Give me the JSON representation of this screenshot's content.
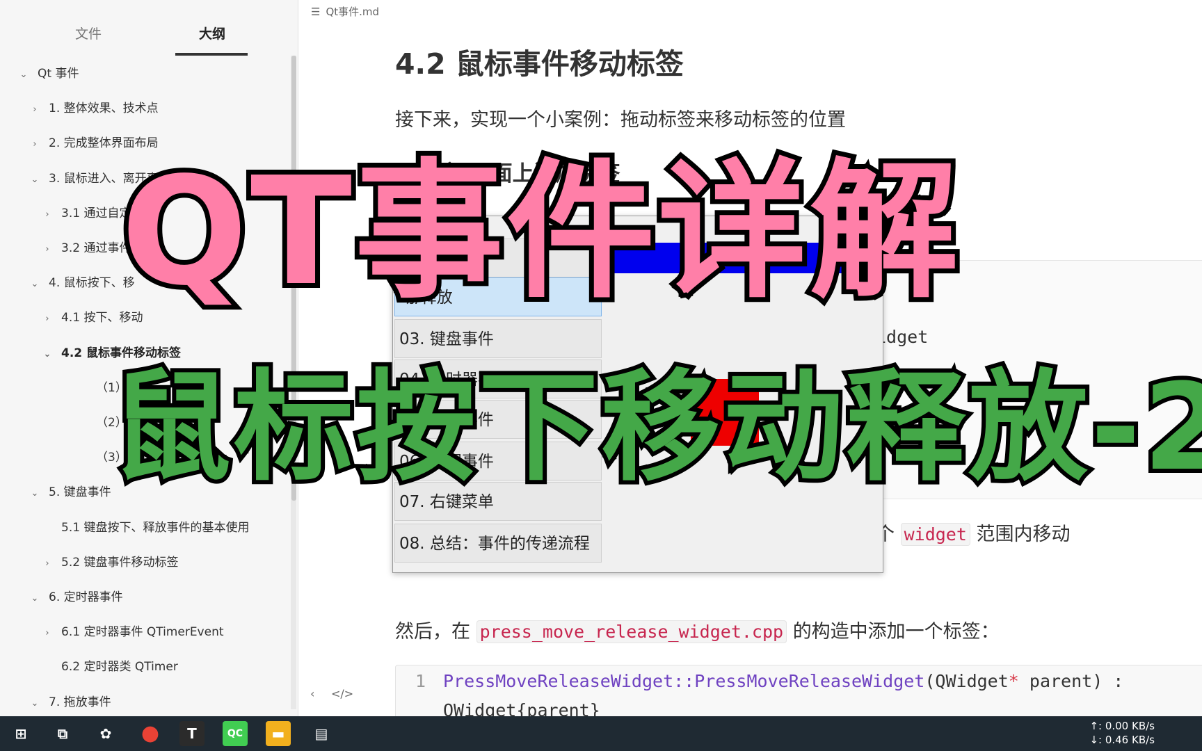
{
  "sidebar": {
    "tabs": {
      "files": "文件",
      "outline": "大纲"
    },
    "outline": [
      {
        "label": "Qt 事件",
        "chevron": "⌄",
        "level": 0
      },
      {
        "label": "1. 整体效果、技术点",
        "chevron": "›",
        "level": 1
      },
      {
        "label": "2. 完成整体界面布局",
        "chevron": "›",
        "level": 1
      },
      {
        "label": "3. 鼠标进入、离开事件",
        "chevron": "⌄",
        "level": 1
      },
      {
        "label": "3.1 通过自定义",
        "chevron": "›",
        "level": 2
      },
      {
        "label": "3.2 通过事件过",
        "chevron": "›",
        "level": 2
      },
      {
        "label": "4. 鼠标按下、移",
        "chevron": "⌄",
        "level": 1
      },
      {
        "label": "4.1 按下、移动",
        "chevron": "›",
        "level": 2
      },
      {
        "label": "4.2 鼠标事件移动标签",
        "chevron": "⌄",
        "level": 2,
        "active": true
      },
      {
        "label": "（1）界",
        "chevron": "",
        "level": 3
      },
      {
        "label": "（2）为",
        "chevron": "",
        "level": 3
      },
      {
        "label": "（3）重",
        "chevron": "",
        "level": 3
      },
      {
        "label": "5. 键盘事件",
        "chevron": "⌄",
        "level": 1
      },
      {
        "label": "5.1 键盘按下、释放事件的基本使用",
        "chevron": "",
        "level": 2
      },
      {
        "label": "5.2 键盘事件移动标签",
        "chevron": "›",
        "level": 2
      },
      {
        "label": "6. 定时器事件",
        "chevron": "⌄",
        "level": 1
      },
      {
        "label": "6.1 定时器事件 QTimerEvent",
        "chevron": "›",
        "level": 2
      },
      {
        "label": "6.2 定时器类 QTimer",
        "chevron": "",
        "level": 2
      },
      {
        "label": "7. 拖放事件",
        "chevron": "⌄",
        "level": 1
      }
    ],
    "footer": {
      "back": "‹",
      "source": "</>"
    }
  },
  "editor": {
    "file_title": "Qt事件.md",
    "h2": "4.2 鼠标事件移动标签",
    "intro": "接下来，实现一个小案例：拖动标签来移动标签的位置",
    "h3": "（1）界面上添加标签",
    "h3_tail": "贯",
    "code_fragment": "idget",
    "range_prefix": "个",
    "range_code": "widget",
    "range_suffix": "范围内移动",
    "then_prefix": "然后，在",
    "then_code": "press_move_release_widget.cpp",
    "then_suffix": "的构造中添加一个标签：",
    "code": {
      "line_no": "1",
      "fn": "PressMoveReleaseWidget::PressMoveReleaseWidget",
      "open": "(",
      "cls": "QWidget",
      "star": "*",
      "rest": " parent) :",
      "line2": "QWidget{parent}"
    }
  },
  "qt_window": {
    "close": "×",
    "items": [
      {
        "label": "",
        "selected": false
      },
      {
        "label": "动/释放",
        "selected": true
      },
      {
        "label": "03. 键盘事件",
        "selected": false
      },
      {
        "label": "04. 定时器事件",
        "selected": false
      },
      {
        "label": "05. 拖动事件",
        "selected": false
      },
      {
        "label": "06. 绘图事件",
        "selected": false
      },
      {
        "label": "07. 右键菜单",
        "selected": false
      },
      {
        "label": "08. 总结：事件的传递流程",
        "selected": false
      }
    ],
    "label_text": "eEvent 22",
    "colors": {
      "label_bg": "#0000ee",
      "red_box": "#ee0000",
      "selected_bg": "#cde5f9"
    }
  },
  "banner": {
    "title": "QT事件详解",
    "subtitle": "鼠标按下移动释放-2",
    "colors": {
      "title": "#ff7fa8",
      "subtitle": "#44a848",
      "outline": "#000000"
    }
  },
  "taskbar": {
    "apps": [
      {
        "icon": "windows-start-icon",
        "glyph": "⊞"
      },
      {
        "icon": "task-view-icon",
        "glyph": "⧉"
      },
      {
        "icon": "flower-app-icon",
        "glyph": "✿"
      },
      {
        "icon": "chrome-icon",
        "glyph": "●"
      },
      {
        "icon": "typora-icon",
        "glyph": "T"
      },
      {
        "icon": "qtcreator-icon",
        "glyph": "QC"
      },
      {
        "icon": "file-explorer-icon",
        "glyph": "▬"
      },
      {
        "icon": "app-window-icon",
        "glyph": "▤"
      }
    ],
    "net_up": "↑: 0.00 KB/s",
    "net_down": "↓: 0.46 KB/s"
  }
}
